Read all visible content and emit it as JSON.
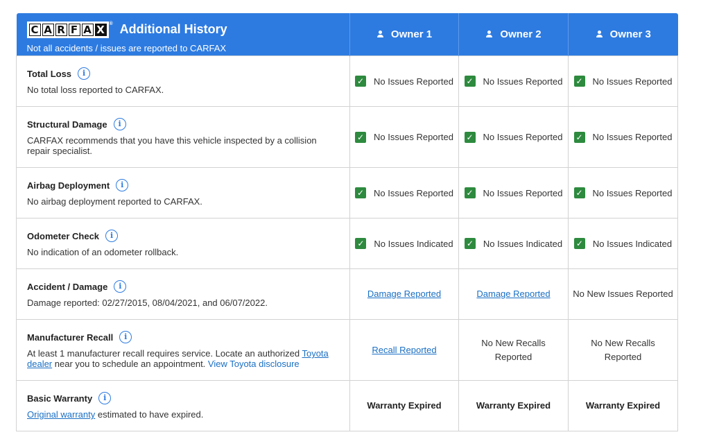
{
  "header": {
    "logo_letters": [
      "C",
      "A",
      "R",
      "F",
      "A",
      "X"
    ],
    "logo_registered": "®",
    "title": "Additional History",
    "subtitle": "Not all accidents / issues are reported to CARFAX",
    "owners": [
      "Owner 1",
      "Owner 2",
      "Owner 3"
    ]
  },
  "icons": {
    "info": "info-circle-icon",
    "check": "check-box-icon",
    "owner": "person-icon"
  },
  "colors": {
    "header_bg": "#2d7be1",
    "check_green": "#2d8a3e",
    "link_blue": "#1a6fc4"
  },
  "rows": [
    {
      "label": "Total Loss",
      "description": "No total loss reported to CARFAX.",
      "owners": [
        "No Issues Reported",
        "No Issues Reported",
        "No Issues Reported"
      ]
    },
    {
      "label": "Structural Damage",
      "description": "CARFAX recommends that you have this vehicle inspected by a collision repair specialist.",
      "owners": [
        "No Issues Reported",
        "No Issues Reported",
        "No Issues Reported"
      ]
    },
    {
      "label": "Airbag Deployment",
      "description": "No airbag deployment reported to CARFAX.",
      "owners": [
        "No Issues Reported",
        "No Issues Reported",
        "No Issues Reported"
      ]
    },
    {
      "label": "Odometer Check",
      "description": "No indication of an odometer rollback.",
      "owners": [
        "No Issues Indicated",
        "No Issues Indicated",
        "No Issues Indicated"
      ]
    },
    {
      "label": "Accident / Damage",
      "description": "Damage reported: 02/27/2015, 08/04/2021, and 06/07/2022.",
      "owners": [
        "Damage Reported",
        "Damage Reported",
        "No New Issues Reported"
      ]
    },
    {
      "label": "Manufacturer Recall",
      "description_parts": [
        "At least 1 manufacturer recall requires service. Locate an authorized ",
        "Toyota dealer",
        " near you to schedule an appointment. ",
        "View Toyota disclosure"
      ],
      "owners": [
        "Recall Reported",
        "No New Recalls Reported",
        "No New Recalls Reported"
      ]
    },
    {
      "label": "Basic Warranty",
      "description_parts": [
        "Original warranty",
        " estimated to have expired."
      ],
      "owners": [
        "Warranty Expired",
        "Warranty Expired",
        "Warranty Expired"
      ]
    }
  ]
}
